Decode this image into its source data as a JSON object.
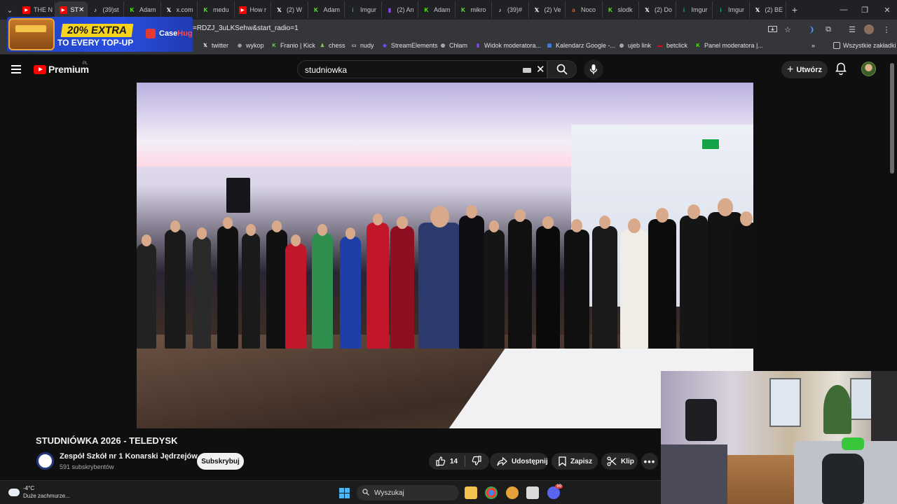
{
  "browser": {
    "tabs": [
      {
        "label": "THE N",
        "icon": "youtube",
        "color": "#ff0000"
      },
      {
        "label": "ST",
        "icon": "youtube",
        "color": "#ff0000",
        "active": true
      },
      {
        "label": "(39)st",
        "icon": "tiktok",
        "color": "#ffffff"
      },
      {
        "label": "Adam",
        "icon": "kick",
        "color": "#53fc18"
      },
      {
        "label": "x.com",
        "icon": "x",
        "color": "#ffffff"
      },
      {
        "label": "medu",
        "icon": "kick",
        "color": "#53fc18"
      },
      {
        "label": "How r",
        "icon": "youtube",
        "color": "#ff0000"
      },
      {
        "label": "(2) W",
        "icon": "x",
        "color": "#ffffff"
      },
      {
        "label": "Adam",
        "icon": "kick",
        "color": "#53fc18"
      },
      {
        "label": "Imgur",
        "icon": "imgur",
        "color": "#1bb76e"
      },
      {
        "label": "(2) An",
        "icon": "twitch",
        "color": "#9146ff"
      },
      {
        "label": "Adam",
        "icon": "kick",
        "color": "#53fc18"
      },
      {
        "label": "mikro",
        "icon": "kick",
        "color": "#53fc18"
      },
      {
        "label": "(39)#",
        "icon": "tiktok",
        "color": "#ffffff"
      },
      {
        "label": "(2) Ve",
        "icon": "x",
        "color": "#ffffff"
      },
      {
        "label": "Noco",
        "icon": "allegro",
        "color": "#ff5a00"
      },
      {
        "label": "slodk",
        "icon": "kick",
        "color": "#53fc18"
      },
      {
        "label": "(2) Do",
        "icon": "x",
        "color": "#ffffff"
      },
      {
        "label": "Imgur",
        "icon": "imgur",
        "color": "#1bb76e"
      },
      {
        "label": "Imgur",
        "icon": "imgur",
        "color": "#1bb76e"
      },
      {
        "label": "(2) BE",
        "icon": "x",
        "color": "#ffffff"
      }
    ],
    "url": "=RDZJ_3uLKSehw&start_radio=1",
    "bookmarks": [
      {
        "label": "twitter",
        "icon": "x",
        "color": "#ffffff"
      },
      {
        "label": "wykop",
        "icon": "wykop",
        "color": "#aaaaaa"
      },
      {
        "label": "Franio | Kick",
        "icon": "kick",
        "color": "#53fc18"
      },
      {
        "label": "chess",
        "icon": "chess",
        "color": "#8fbc5a"
      },
      {
        "label": "nudy",
        "icon": "folder",
        "color": "#cccccc"
      },
      {
        "label": "StreamElements",
        "icon": "streamelements",
        "color": "#6b4cff"
      },
      {
        "label": "Chłam",
        "icon": "globe",
        "color": "#cccccc"
      },
      {
        "label": "Widok moderatora...",
        "icon": "twitch",
        "color": "#9146ff"
      },
      {
        "label": "Kalendarz Google -...",
        "icon": "calendar",
        "color": "#4285f4"
      },
      {
        "label": "ujeb link",
        "icon": "globe",
        "color": "#cccccc"
      },
      {
        "label": "betclick",
        "icon": "betclick",
        "color": "#e30613"
      },
      {
        "label": "Panel moderatora |...",
        "icon": "kick",
        "color": "#53fc18"
      }
    ],
    "all_bookmarks": "Wszystkie zakładki"
  },
  "ad": {
    "badge": "20% EXTRA",
    "line2": "TO EVERY TOP-UP",
    "brand_a": "Case",
    "brand_b": "Hug"
  },
  "youtube": {
    "logo": "Premium",
    "logo_country": "PL",
    "search_query": "studniowka",
    "create_label": "Utwórz"
  },
  "video": {
    "title": "STUDNIÓWKA 2026 - TELEDYSK",
    "channel_name": "Zespół Szkół nr 1 Konarski Jędrzejów",
    "subscribers": "591 subskrybentów",
    "subscribe_label": "Subskrybuj",
    "likes": "14",
    "share_label": "Udostępnij",
    "save_label": "Zapisz",
    "clip_label": "Klip"
  },
  "taskbar": {
    "temperature": "-4°C",
    "weather_desc": "Duże zachmurze...",
    "search_placeholder": "Wyszukaj",
    "discord_badge": "99"
  }
}
